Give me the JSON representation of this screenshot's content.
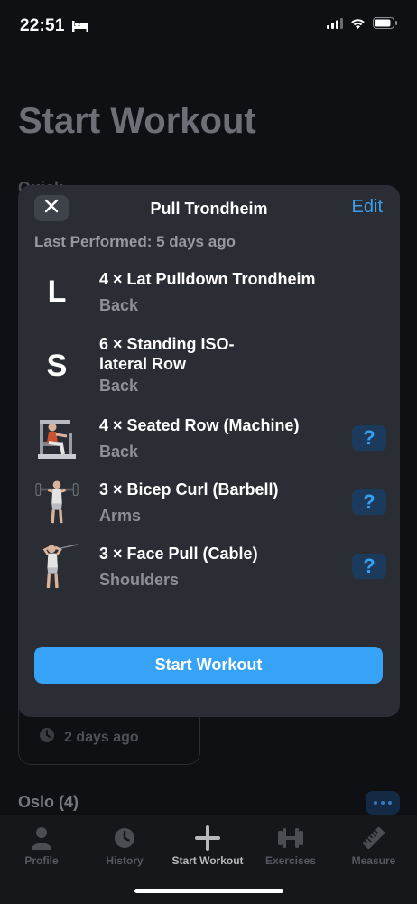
{
  "status_bar": {
    "time": "22:51",
    "icons": [
      "bed-icon",
      "cellular-signal-icon",
      "wifi-icon",
      "battery-icon"
    ]
  },
  "background": {
    "title": "Start Workout",
    "peek_text": "Quick",
    "card_time": "2 days ago",
    "section_title": "Oslo (4)"
  },
  "modal": {
    "title": "Pull Trondheim",
    "close_icon": "close-icon",
    "edit_label": "Edit",
    "last_performed": "Last Performed: 5 days ago",
    "exercises": [
      {
        "letter": "L",
        "line1": "4 × Lat Pulldown Trondheim",
        "line2": "",
        "muscle": "Back",
        "help": ""
      },
      {
        "letter": "S",
        "line1": "6 × Standing ISO-",
        "line2": "lateral Row",
        "muscle": "Back",
        "help": ""
      },
      {
        "letter": "",
        "line1": "4 × Seated Row (Machine)",
        "line2": "",
        "muscle": "Back",
        "help": "?"
      },
      {
        "letter": "",
        "line1": "3 × Bicep Curl (Barbell)",
        "line2": "",
        "muscle": "Arms",
        "help": "?"
      },
      {
        "letter": "",
        "line1": "3 × Face Pull (Cable)",
        "line2": "",
        "muscle": "Shoulders",
        "help": "?"
      }
    ],
    "start_label": "Start Workout"
  },
  "tabbar": {
    "items": [
      {
        "label": "Profile",
        "icon": "person-icon"
      },
      {
        "label": "History",
        "icon": "clock-icon"
      },
      {
        "label": "Start Workout",
        "icon": "plus-icon",
        "active": true
      },
      {
        "label": "Exercises",
        "icon": "dumbbell-icon"
      },
      {
        "label": "Measure",
        "icon": "ruler-icon"
      }
    ]
  },
  "colors": {
    "accent": "#37a3f6",
    "modal_bg": "#2a2d33",
    "page_bg": "#0e1013"
  }
}
